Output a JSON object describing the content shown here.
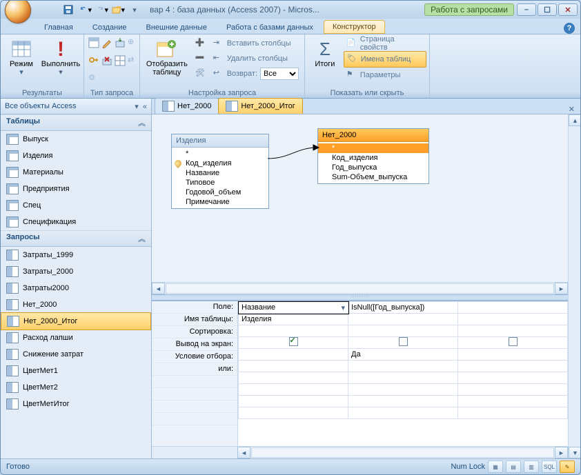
{
  "title": {
    "app": "вар 4 : база данных (Access 2007) - Micros...",
    "context": "Работа с запросами"
  },
  "tabs": {
    "home": "Главная",
    "create": "Создание",
    "external": "Внешние данные",
    "dbtools": "Работа с базами данных",
    "design": "Конструктор"
  },
  "ribbon": {
    "results": {
      "label": "Результаты",
      "view": "Режим",
      "run": "Выполнить"
    },
    "querytype": {
      "label": "Тип запроса"
    },
    "setup": {
      "label": "Настройка запроса",
      "showtable": "Отобразить таблицу",
      "insertcols": "Вставить столбцы",
      "deletecols": "Удалить столбцы",
      "return": "Возврат:",
      "return_value": "Все"
    },
    "showhide": {
      "label": "Показать или скрыть",
      "totals": "Итоги",
      "propsheet": "Страница свойств",
      "tablenames": "Имена таблиц",
      "params": "Параметры"
    }
  },
  "nav": {
    "header": "Все объекты Access",
    "tables_hdr": "Таблицы",
    "tables": [
      "Выпуск",
      "Изделия",
      "Материалы",
      "Предприятия",
      "Спец",
      "Спецификация"
    ],
    "queries_hdr": "Запросы",
    "queries": [
      "Затраты_1999",
      "Затраты_2000",
      "Затраты2000",
      "Нет_2000",
      "Нет_2000_Итог",
      "Расход лапши",
      "Снижение затрат",
      "ЦветМет1",
      "ЦветМет2",
      "ЦветМетИтог"
    ],
    "selected_query": "Нет_2000_Итог"
  },
  "doctabs": {
    "t1": "Нет_2000",
    "t2": "Нет_2000_Итог"
  },
  "canvas": {
    "box1": {
      "title": "Изделия",
      "fields": [
        "*",
        "Код_изделия",
        "Название",
        "Типовое",
        "Годовой_объем",
        "Примечание"
      ]
    },
    "box2": {
      "title": "Нет_2000",
      "fields": [
        "*",
        "Код_изделия",
        "Год_выпуска",
        "Sum-Объем_выпуска"
      ]
    }
  },
  "grid": {
    "labels": {
      "field": "Поле:",
      "table": "Имя таблицы:",
      "sort": "Сортировка:",
      "show": "Вывод на экран:",
      "criteria": "Условие отбора:",
      "or": "или:"
    },
    "col1": {
      "field": "Название",
      "table": "Изделия",
      "show": true
    },
    "col2": {
      "field": "IsNull([Год_выпуска])",
      "criteria": "Да",
      "show": false
    },
    "col3": {
      "show": false
    }
  },
  "status": {
    "ready": "Готово",
    "numlock": "Num Lock"
  }
}
